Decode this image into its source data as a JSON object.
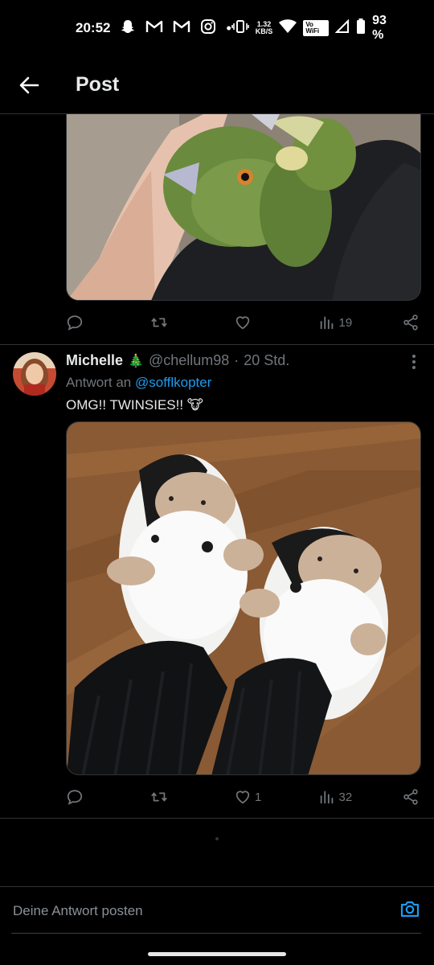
{
  "status_bar": {
    "time": "20:52",
    "net_speed": "1.32",
    "net_unit": "KB/S",
    "volte": "Vo WiFi",
    "battery": "93 %"
  },
  "header": {
    "title": "Post"
  },
  "tweet1": {
    "views": "19"
  },
  "tweet2": {
    "name": "Michelle",
    "name_emoji": "🎄",
    "handle": "@chellum98",
    "separator": "·",
    "time": "20 Std.",
    "reply_prefix": "Antwort an",
    "reply_mention": "@sofflkopter",
    "text": "OMG!! TWINSIES!! 🐮",
    "likes": "1",
    "views": "32"
  },
  "composer": {
    "placeholder": "Deine Antwort posten"
  },
  "icons": {
    "back": "arrow-left-icon",
    "reply": "reply-icon",
    "repost": "repost-icon",
    "like": "heart-icon",
    "views": "views-icon",
    "share": "share-icon",
    "camera": "camera-icon",
    "more": "more-vertical-icon"
  },
  "colors": {
    "background": "#000000",
    "accent": "#1d9bf0",
    "muted": "#71767b",
    "divider": "#2f3336"
  }
}
